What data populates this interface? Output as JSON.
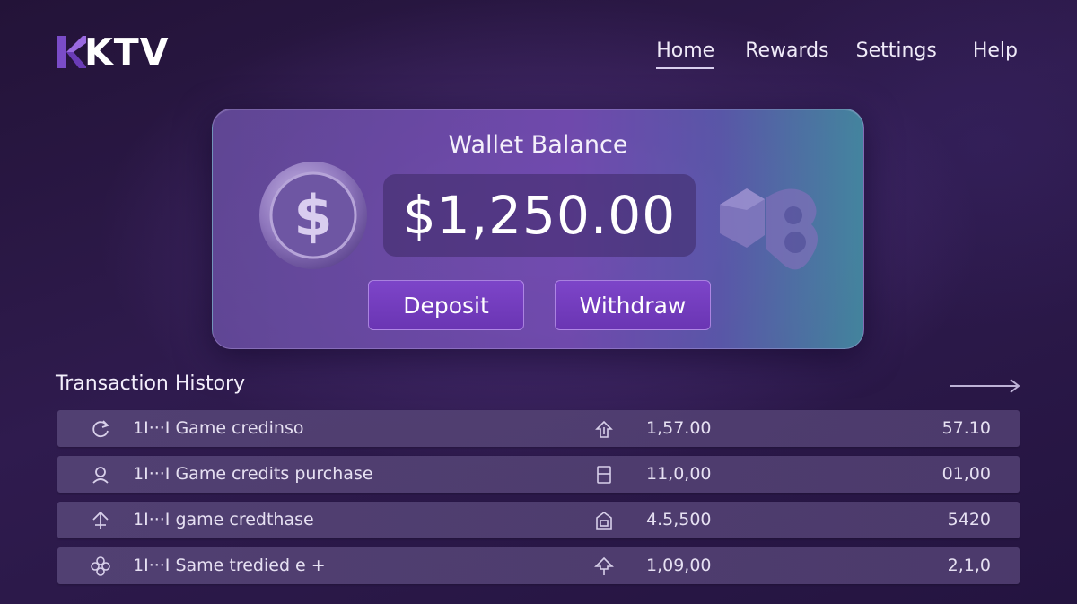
{
  "brand": {
    "logo_text": "KTV"
  },
  "nav": {
    "items": [
      "Home",
      "Rewards",
      "Settings",
      "Help"
    ],
    "active": "Home"
  },
  "wallet": {
    "title": "Wallet Balance",
    "balance": "$1,250.00",
    "deposit_label": "Deposit",
    "withdraw_label": "Withdraw"
  },
  "transactions": {
    "title": "Transaction History",
    "rows": [
      {
        "icon": "refresh-icon",
        "description": "1I···I Game credinso",
        "type_icon": "upload-icon",
        "amount": "1,57.00",
        "balance": "57.10"
      },
      {
        "icon": "user-icon",
        "description": "1I···I Game credits purchase",
        "type_icon": "document-icon",
        "amount": "11,0,00",
        "balance": "01,00"
      },
      {
        "icon": "arrow-up-icon",
        "description": "1I···I game credthase",
        "type_icon": "lock-icon",
        "amount": "4.5,500",
        "balance": "5420"
      },
      {
        "icon": "flower-icon",
        "description": "1I···I Same tredied e  +",
        "type_icon": "arrow-up-outline-icon",
        "amount": "1,09,00",
        "balance": "2,1,0"
      }
    ]
  },
  "colors": {
    "accent": "#7d45c9",
    "background": "#2a1844",
    "teal_glow": "#46a0aa"
  }
}
